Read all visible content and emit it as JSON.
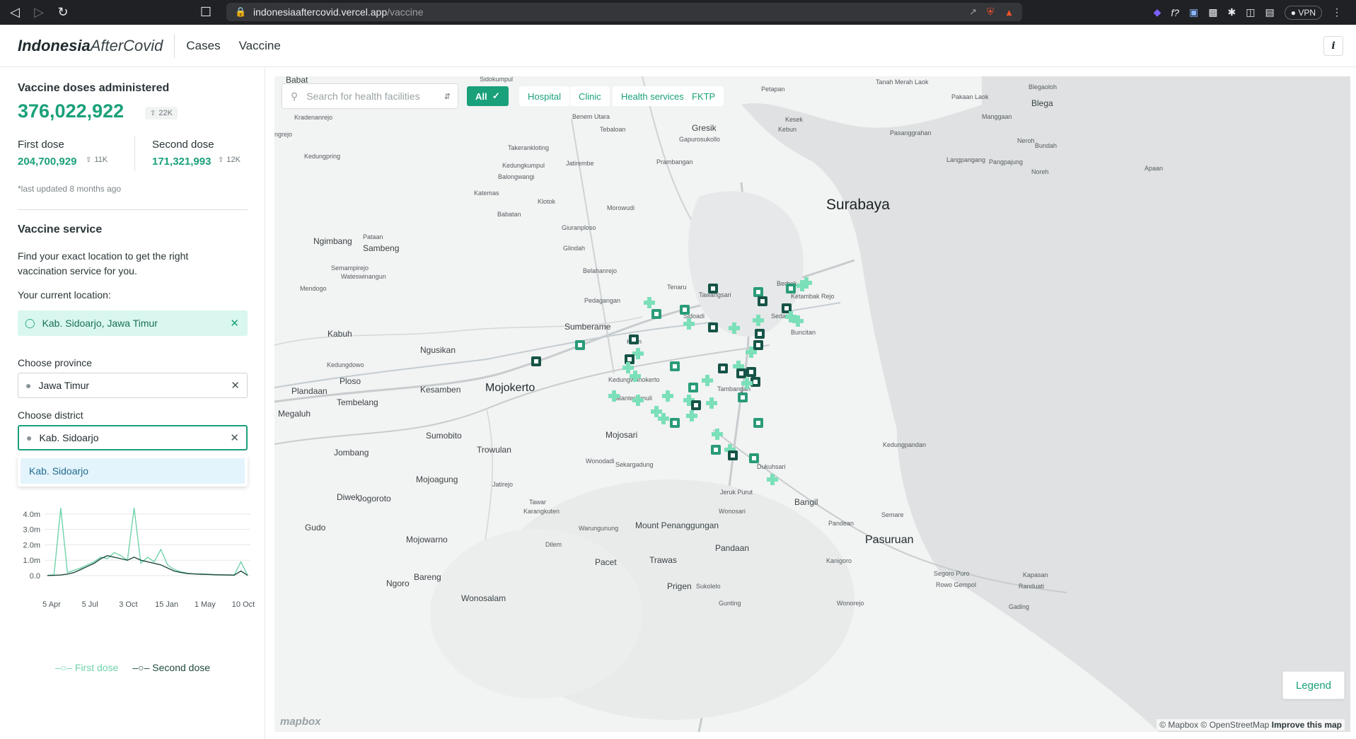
{
  "browser": {
    "url_host": "indonesiaaftercovid.vercel.app",
    "url_path": "/vaccine",
    "vpn_label": "VPN"
  },
  "header": {
    "logo_bold": "Indonesia",
    "logo_italic": "AfterCovid",
    "nav": [
      "Cases",
      "Vaccine"
    ],
    "info_label": "i"
  },
  "summary": {
    "title": "Vaccine doses administered",
    "total": "376,022,922",
    "total_delta": "22K",
    "first_label": "First dose",
    "first_value": "204,700,929",
    "first_delta": "11K",
    "second_label": "Second dose",
    "second_value": "171,321,993",
    "second_delta": "12K",
    "updated": "*last updated 8 months ago"
  },
  "service": {
    "title": "Vaccine service",
    "description": "Find your exact location to get the right vaccination service for you.",
    "current_location_label": "Your current location:",
    "current_location": "Kab. Sidoarjo, Jawa Timur",
    "province_label": "Choose province",
    "province_value": "Jawa Timur",
    "district_label": "Choose district",
    "district_value": "Kab. Sidoarjo",
    "district_option": "Kab. Sidoarjo"
  },
  "chart_data": {
    "type": "line",
    "y_ticks": [
      "4.0m",
      "3.0m",
      "2.0m",
      "1.0m",
      "0.0"
    ],
    "x_ticks": [
      "5 Apr",
      "5 Jul",
      "3 Oct",
      "15 Jan",
      "1 May",
      "10 Oct"
    ],
    "ylim": [
      0,
      4500000
    ],
    "series": [
      {
        "name": "First dose",
        "color": "#6fd3a8",
        "values": [
          20000,
          60000,
          4400000,
          200000,
          350000,
          500000,
          700000,
          900000,
          1200000,
          1100000,
          1500000,
          1300000,
          1000000,
          4400000,
          800000,
          1200000,
          900000,
          1700000,
          700000,
          400000,
          250000,
          150000,
          120000,
          100000,
          90000,
          70000,
          60000,
          50000,
          40000,
          900000,
          30000
        ]
      },
      {
        "name": "Second dose",
        "color": "#1f4a3d",
        "values": [
          10000,
          20000,
          40000,
          100000,
          200000,
          400000,
          600000,
          800000,
          1100000,
          1300000,
          1200000,
          1100000,
          1000000,
          1200000,
          1000000,
          900000,
          800000,
          700000,
          500000,
          300000,
          200000,
          140000,
          110000,
          90000,
          80000,
          60000,
          50000,
          40000,
          30000,
          300000,
          20000
        ]
      }
    ]
  },
  "map": {
    "search_placeholder": "Search for health facilities",
    "filters": [
      "All",
      "Hospital",
      "Clinic",
      "Health services",
      "FKTP"
    ],
    "legend_button": "Legend",
    "attribution_prefix": "© Mapbox © OpenStreetMap",
    "attribution_link": "Improve this map",
    "mapbox_logo": "mapbox",
    "labels": [
      {
        "text": "Surabaya",
        "size": "l",
        "x": 780,
        "y": 170
      },
      {
        "text": "Mojokerto",
        "size": "m",
        "x": 298,
        "y": 432
      },
      {
        "text": "Pasuruan",
        "size": "m",
        "x": 835,
        "y": 647
      },
      {
        "text": "Babat",
        "size": "s",
        "x": 16,
        "y": -2
      },
      {
        "text": "Sidokumpul",
        "size": "xs",
        "x": 290,
        "y": -1
      },
      {
        "text": "Petapan",
        "size": "xs",
        "x": 688,
        "y": 13
      },
      {
        "text": "Tanah Merah Laok",
        "size": "xs",
        "x": 850,
        "y": 3
      },
      {
        "text": "Blegaoloh",
        "size": "xs",
        "x": 1066,
        "y": 10
      },
      {
        "text": "Pakaan Laok",
        "size": "xs",
        "x": 957,
        "y": 24
      },
      {
        "text": "Blega",
        "size": "s",
        "x": 1070,
        "y": 31
      },
      {
        "text": "Kradenanrejo",
        "size": "xs",
        "x": 28,
        "y": 53
      },
      {
        "text": "Benem Utara",
        "size": "xs",
        "x": 421,
        "y": 52
      },
      {
        "text": "Kesek",
        "size": "xs",
        "x": 722,
        "y": 56
      },
      {
        "text": "Manggaan",
        "size": "xs",
        "x": 1000,
        "y": 52
      },
      {
        "text": "ngrejo",
        "size": "xs",
        "x": 0,
        "y": 77
      },
      {
        "text": "Tebaloan",
        "size": "xs",
        "x": 460,
        "y": 70
      },
      {
        "text": "Gresik",
        "size": "s",
        "x": 590,
        "y": 66
      },
      {
        "text": "Kebun",
        "size": "xs",
        "x": 712,
        "y": 70
      },
      {
        "text": "Pasanggrahan",
        "size": "xs",
        "x": 870,
        "y": 75
      },
      {
        "text": "Gapurosukollo",
        "size": "xs",
        "x": 572,
        "y": 84
      },
      {
        "text": "Neroh",
        "size": "xs",
        "x": 1050,
        "y": 86
      },
      {
        "text": "Bundah",
        "size": "xs",
        "x": 1075,
        "y": 93
      },
      {
        "text": "Takerankloting",
        "size": "xs",
        "x": 330,
        "y": 96
      },
      {
        "text": "Kedungpring",
        "size": "xs",
        "x": 42,
        "y": 108
      },
      {
        "text": "Prambangan",
        "size": "xs",
        "x": 540,
        "y": 116
      },
      {
        "text": "Langpangang",
        "size": "xs",
        "x": 950,
        "y": 113
      },
      {
        "text": "Pangpajung",
        "size": "xs",
        "x": 1010,
        "y": 116
      },
      {
        "text": "Apaan",
        "size": "xs",
        "x": 1230,
        "y": 125
      },
      {
        "text": "Kedungkumpul",
        "size": "xs",
        "x": 322,
        "y": 121
      },
      {
        "text": "Jatirembe",
        "size": "xs",
        "x": 412,
        "y": 118
      },
      {
        "text": "Noreh",
        "size": "xs",
        "x": 1070,
        "y": 130
      },
      {
        "text": "Balongwangi",
        "size": "xs",
        "x": 316,
        "y": 137
      },
      {
        "text": "Katemas",
        "size": "xs",
        "x": 282,
        "y": 160
      },
      {
        "text": "Klotok",
        "size": "xs",
        "x": 372,
        "y": 172
      },
      {
        "text": "Morowudi",
        "size": "xs",
        "x": 470,
        "y": 181
      },
      {
        "text": "Babatan",
        "size": "xs",
        "x": 315,
        "y": 190
      },
      {
        "text": "Giuranploso",
        "size": "xs",
        "x": 406,
        "y": 209
      },
      {
        "text": "Ngimbang",
        "size": "s",
        "x": 55,
        "y": 226
      },
      {
        "text": "Pataan",
        "size": "xs",
        "x": 125,
        "y": 222
      },
      {
        "text": "Sambeng",
        "size": "s",
        "x": 125,
        "y": 236
      },
      {
        "text": "Glindah",
        "size": "xs",
        "x": 408,
        "y": 238
      },
      {
        "text": "Semampirejo",
        "size": "xs",
        "x": 80,
        "y": 266
      },
      {
        "text": "Wateswinangun",
        "size": "xs",
        "x": 94,
        "y": 278
      },
      {
        "text": "Belahanrejo",
        "size": "xs",
        "x": 436,
        "y": 270
      },
      {
        "text": "Mendogo",
        "size": "xs",
        "x": 36,
        "y": 295
      },
      {
        "text": "Tenaru",
        "size": "xs",
        "x": 555,
        "y": 293
      },
      {
        "text": "Pedagangan",
        "size": "xs",
        "x": 438,
        "y": 312
      },
      {
        "text": "Sumberame",
        "size": "s",
        "x": 410,
        "y": 347
      },
      {
        "text": "Kabuh",
        "size": "s",
        "x": 75,
        "y": 357
      },
      {
        "text": "Ngusikan",
        "size": "s",
        "x": 206,
        "y": 380
      },
      {
        "text": "Kedungdowo",
        "size": "xs",
        "x": 74,
        "y": 403
      },
      {
        "text": "Ploso",
        "size": "s",
        "x": 92,
        "y": 424
      },
      {
        "text": "Plandaan",
        "size": "s",
        "x": 24,
        "y": 438
      },
      {
        "text": "Kesamben",
        "size": "s",
        "x": 206,
        "y": 436
      },
      {
        "text": "Kedungwonokerto",
        "size": "xs",
        "x": 472,
        "y": 424
      },
      {
        "text": "Tembelang",
        "size": "s",
        "x": 88,
        "y": 454
      },
      {
        "text": "Kalantengmuli",
        "size": "xs",
        "x": 477,
        "y": 450
      },
      {
        "text": "Megaluh",
        "size": "s",
        "x": 5,
        "y": 470
      },
      {
        "text": "Sumobito",
        "size": "s",
        "x": 214,
        "y": 501
      },
      {
        "text": "Mojosari",
        "size": "s",
        "x": 468,
        "y": 500
      },
      {
        "text": "Kedungpandan",
        "size": "xs",
        "x": 860,
        "y": 516
      },
      {
        "text": "Jombang",
        "size": "s",
        "x": 84,
        "y": 525
      },
      {
        "text": "Trowulan",
        "size": "s",
        "x": 286,
        "y": 521
      },
      {
        "text": "Wonodadi",
        "size": "xs",
        "x": 440,
        "y": 539
      },
      {
        "text": "Sekargadung",
        "size": "xs",
        "x": 482,
        "y": 544
      },
      {
        "text": "Mojoagung",
        "size": "s",
        "x": 200,
        "y": 563
      },
      {
        "text": "Jatirejo",
        "size": "xs",
        "x": 308,
        "y": 572
      },
      {
        "text": "Jeruk Purut",
        "size": "xs",
        "x": 630,
        "y": 583
      },
      {
        "text": "Diwek",
        "size": "s",
        "x": 88,
        "y": 588
      },
      {
        "text": "Jogoroto",
        "size": "s",
        "x": 118,
        "y": 590
      },
      {
        "text": "Bangil",
        "size": "s",
        "x": 735,
        "y": 595
      },
      {
        "text": "Tawar",
        "size": "xs",
        "x": 360,
        "y": 597
      },
      {
        "text": "Karangkuten",
        "size": "xs",
        "x": 352,
        "y": 610
      },
      {
        "text": "Wonosari",
        "size": "xs",
        "x": 628,
        "y": 610
      },
      {
        "text": "Semare",
        "size": "xs",
        "x": 858,
        "y": 615
      },
      {
        "text": "Mount Penanggungan",
        "size": "s",
        "x": 510,
        "y": 628
      },
      {
        "text": "Pandean",
        "size": "xs",
        "x": 783,
        "y": 627
      },
      {
        "text": "Gudo",
        "size": "s",
        "x": 43,
        "y": 631
      },
      {
        "text": "Warungunung",
        "size": "xs",
        "x": 430,
        "y": 634
      },
      {
        "text": "Mojowarno",
        "size": "s",
        "x": 186,
        "y": 648
      },
      {
        "text": "Dilem",
        "size": "xs",
        "x": 383,
        "y": 657
      },
      {
        "text": "Pandaan",
        "size": "s",
        "x": 623,
        "y": 660
      },
      {
        "text": "Kanigoro",
        "size": "xs",
        "x": 780,
        "y": 680
      },
      {
        "text": "Pacet",
        "size": "s",
        "x": 453,
        "y": 680
      },
      {
        "text": "Trawas",
        "size": "s",
        "x": 530,
        "y": 677
      },
      {
        "text": "Kapasan",
        "size": "xs",
        "x": 1058,
        "y": 700
      },
      {
        "text": "Bareng",
        "size": "s",
        "x": 197,
        "y": 701
      },
      {
        "text": "Segoro Puro",
        "size": "xs",
        "x": 932,
        "y": 698
      },
      {
        "text": "Ngoro",
        "size": "s",
        "x": 158,
        "y": 710
      },
      {
        "text": "Prigen",
        "size": "s",
        "x": 555,
        "y": 714
      },
      {
        "text": "Sukolelo",
        "size": "xs",
        "x": 596,
        "y": 716
      },
      {
        "text": "Rowo Gempol",
        "size": "xs",
        "x": 935,
        "y": 714
      },
      {
        "text": "Randuati",
        "size": "xs",
        "x": 1052,
        "y": 716
      },
      {
        "text": "Wonosalam",
        "size": "s",
        "x": 264,
        "y": 731
      },
      {
        "text": "Gunting",
        "size": "xs",
        "x": 628,
        "y": 740
      },
      {
        "text": "Wonorejo",
        "size": "xs",
        "x": 795,
        "y": 740
      },
      {
        "text": "Gading",
        "size": "xs",
        "x": 1038,
        "y": 745
      },
      {
        "text": "Tawangsari",
        "size": "xs",
        "x": 600,
        "y": 304
      },
      {
        "text": "Berbek",
        "size": "xs",
        "x": 710,
        "y": 288
      },
      {
        "text": "Ketambak Rejo",
        "size": "xs",
        "x": 730,
        "y": 306
      },
      {
        "text": "Sedati",
        "size": "xs",
        "x": 702,
        "y": 334
      },
      {
        "text": "Buncitan",
        "size": "xs",
        "x": 730,
        "y": 357
      },
      {
        "text": "Sidoadi",
        "size": "xs",
        "x": 578,
        "y": 334
      },
      {
        "text": "Tambangan",
        "size": "xs",
        "x": 626,
        "y": 437
      },
      {
        "text": "Dukuhsari",
        "size": "xs",
        "x": 682,
        "y": 547
      },
      {
        "text": "Krian",
        "size": "xs",
        "x": 498,
        "y": 370
      }
    ]
  }
}
